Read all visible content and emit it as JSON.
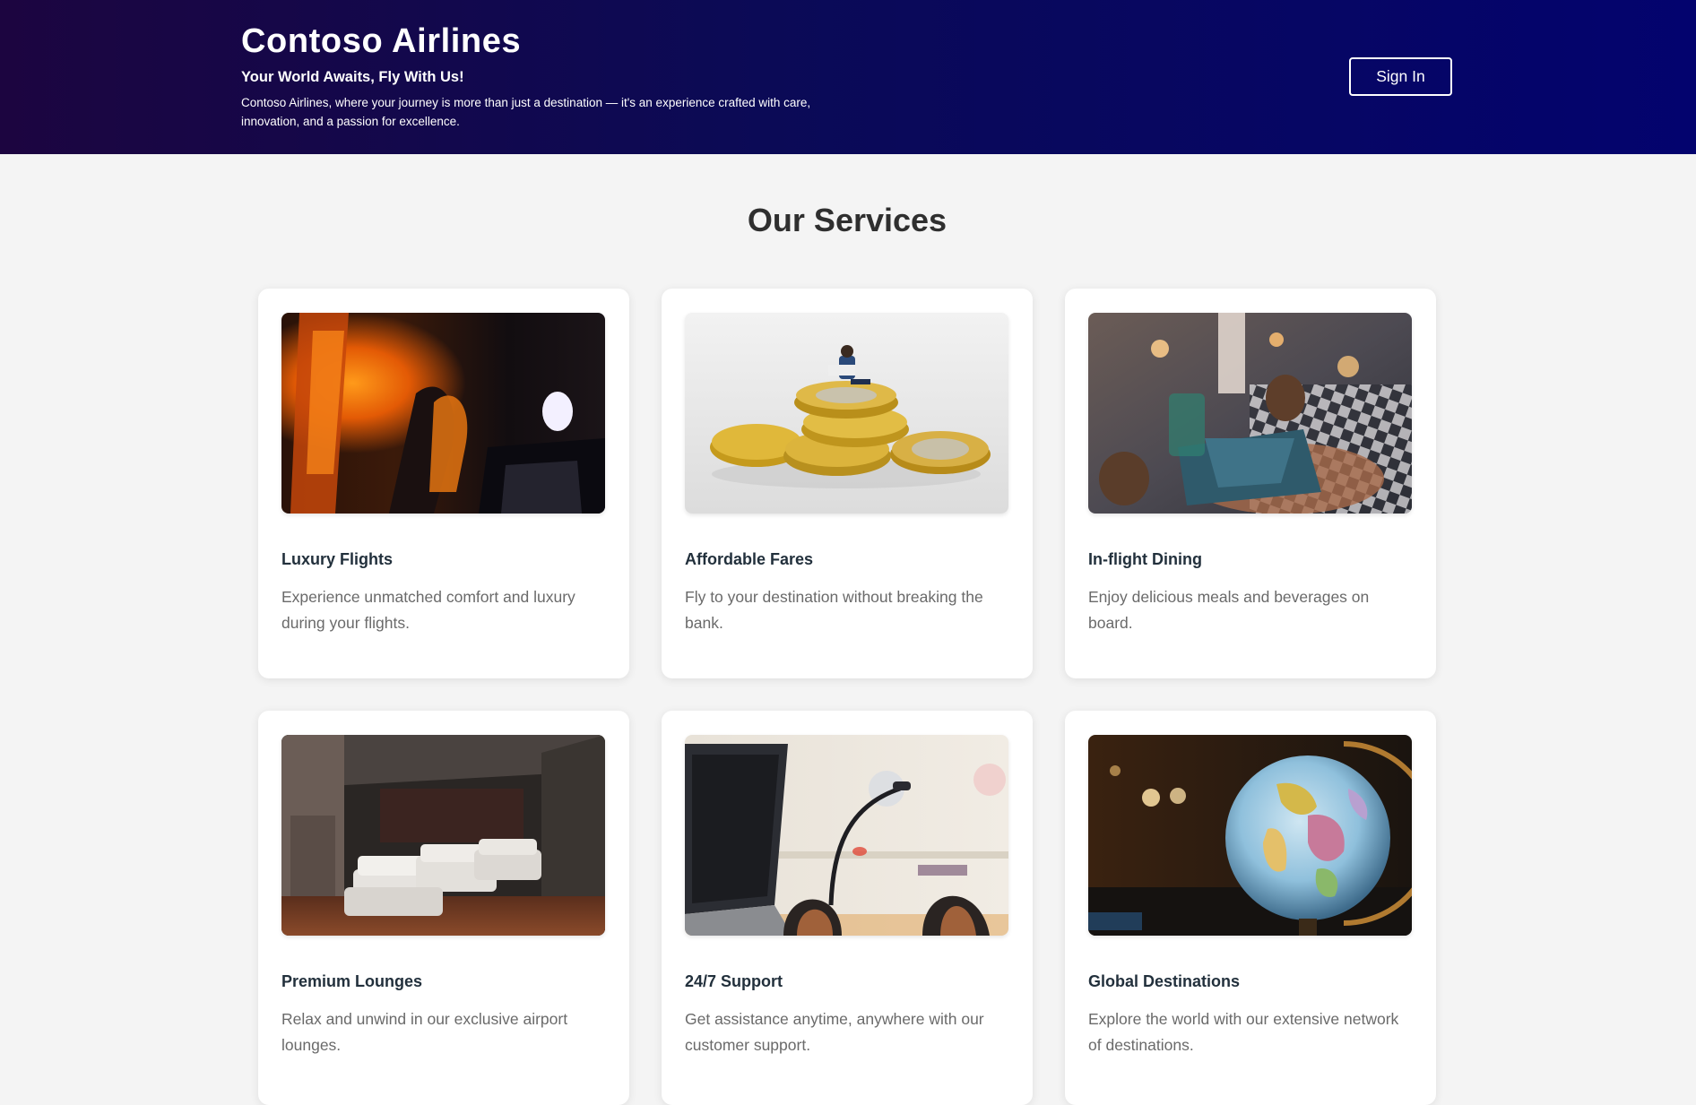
{
  "header": {
    "title": "Contoso Airlines",
    "tagline": "Your World Awaits, Fly With Us!",
    "description": "Contoso Airlines, where your journey is more than just a destination — it's an experience crafted with care, innovation, and a passion for excellence.",
    "signin_label": "Sign In"
  },
  "services": {
    "heading": "Our Services",
    "items": [
      {
        "title": "Luxury Flights",
        "text": "Experience unmatched comfort and luxury during your flights."
      },
      {
        "title": "Affordable Fares",
        "text": "Fly to your destination without breaking the bank."
      },
      {
        "title": "In-flight Dining",
        "text": "Enjoy delicious meals and beverages on board."
      },
      {
        "title": "Premium Lounges",
        "text": "Relax and unwind in our exclusive airport lounges."
      },
      {
        "title": "24/7 Support",
        "text": "Get assistance anytime, anywhere with our customer support."
      },
      {
        "title": "Global Destinations",
        "text": "Explore the world with our extensive network of destinations."
      }
    ]
  },
  "colors": {
    "header_gradient_start": "#1c0540",
    "header_gradient_end": "#03036e",
    "page_background": "#f4f4f4",
    "card_background": "#ffffff"
  }
}
